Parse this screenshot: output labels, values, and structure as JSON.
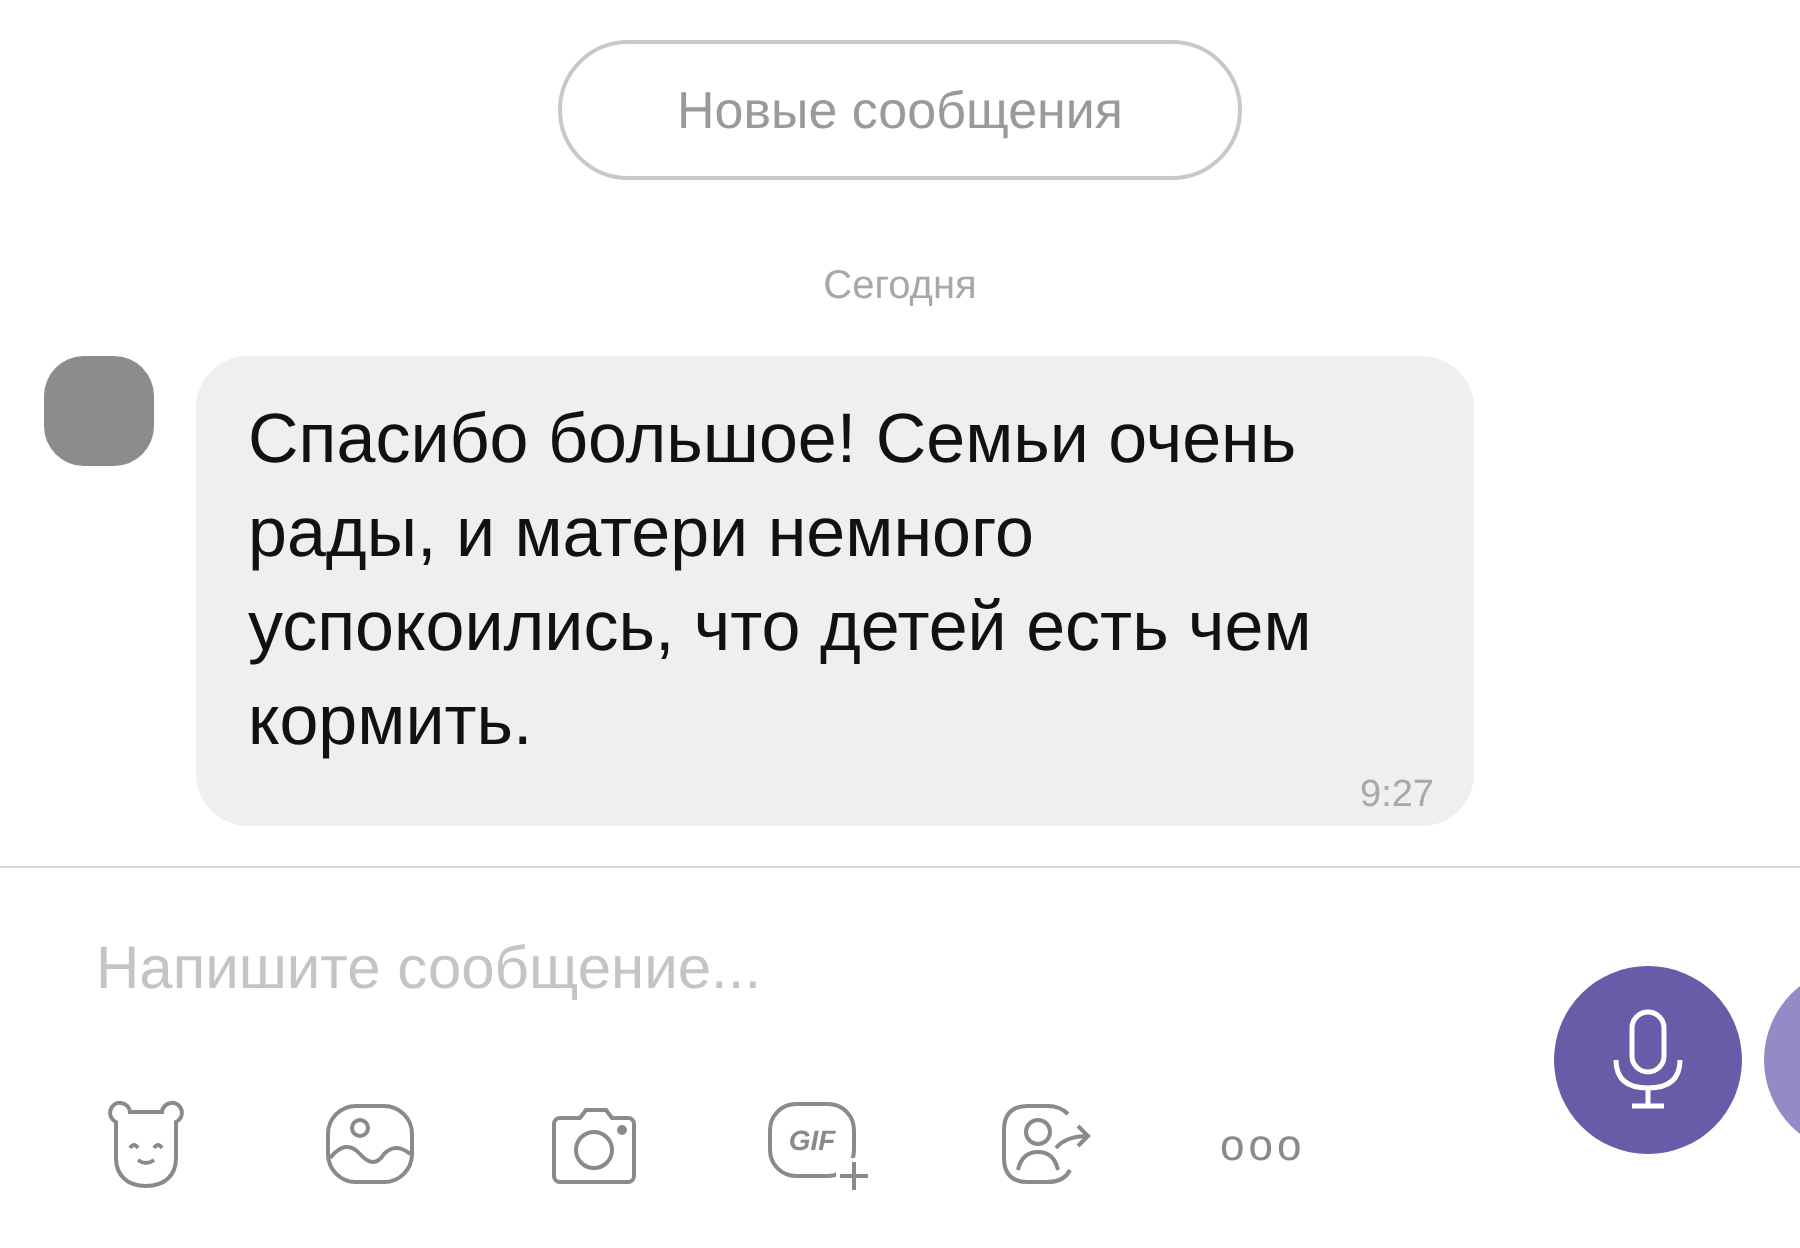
{
  "new_messages_button": {
    "label": "Новые сообщения"
  },
  "date_separator": "Сегодня",
  "messages": [
    {
      "text": "Спасибо большое! Семьи очень рады, и матери немного успокоились, что детей есть чем кормить.",
      "time": "9:27"
    }
  ],
  "composer": {
    "placeholder": "Напишите сообщение..."
  },
  "toolbar": {
    "gif_label": "GIF",
    "more_label": "ooo"
  }
}
